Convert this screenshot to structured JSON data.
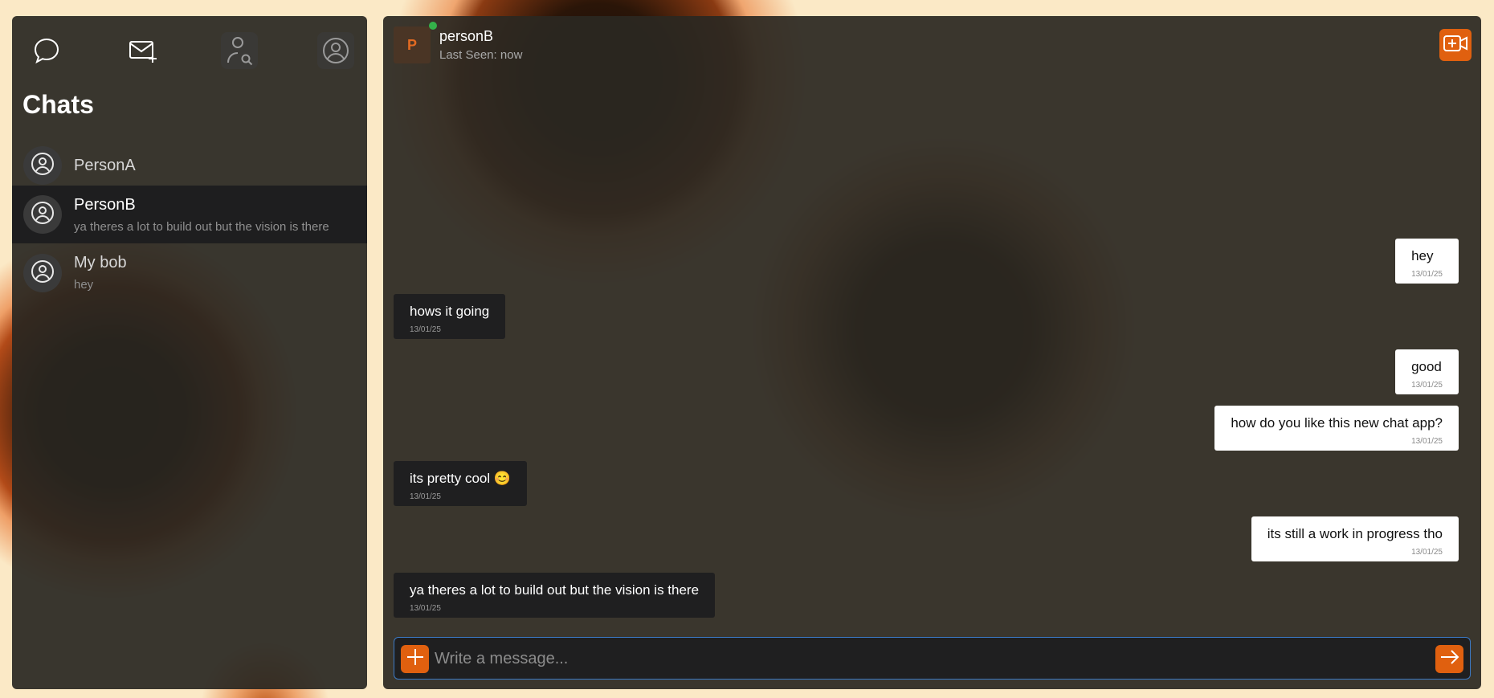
{
  "colors": {
    "accent": "#e0600f",
    "online": "#34b24a",
    "panel_bg": "#2b2821",
    "outgoing_bubble": "#ffffff",
    "incoming_bubble": "#1f1f20",
    "input_border": "#3b79c4"
  },
  "nav": {
    "icons": [
      "chat-bubble-icon",
      "new-mail-icon",
      "user-search-icon",
      "profile-icon"
    ]
  },
  "sidebar": {
    "title": "Chats",
    "chats": [
      {
        "name": "PersonA",
        "preview": ""
      },
      {
        "name": "PersonB",
        "preview": "ya theres a lot to build out but the vision is there",
        "selected": true
      },
      {
        "name": "My bob",
        "preview": "hey"
      }
    ]
  },
  "conversation": {
    "avatar_letter": "P",
    "name": "personB",
    "last_seen": "Last Seen: now",
    "messages": [
      {
        "direction": "out",
        "text": "hey",
        "time": "13/01/25"
      },
      {
        "direction": "in",
        "text": "hows it going",
        "time": "13/01/25"
      },
      {
        "direction": "out",
        "text": "good",
        "time": "13/01/25"
      },
      {
        "direction": "out",
        "text": "how do you like this new chat app?",
        "time": "13/01/25"
      },
      {
        "direction": "in",
        "text": "its pretty cool 😊",
        "time": "13/01/25"
      },
      {
        "direction": "out",
        "text": "its still a work in progress tho",
        "time": "13/01/25"
      },
      {
        "direction": "in",
        "text": "ya theres a lot to build out but the vision is there",
        "time": "13/01/25"
      }
    ]
  },
  "composer": {
    "placeholder": "Write a message...",
    "value": ""
  }
}
